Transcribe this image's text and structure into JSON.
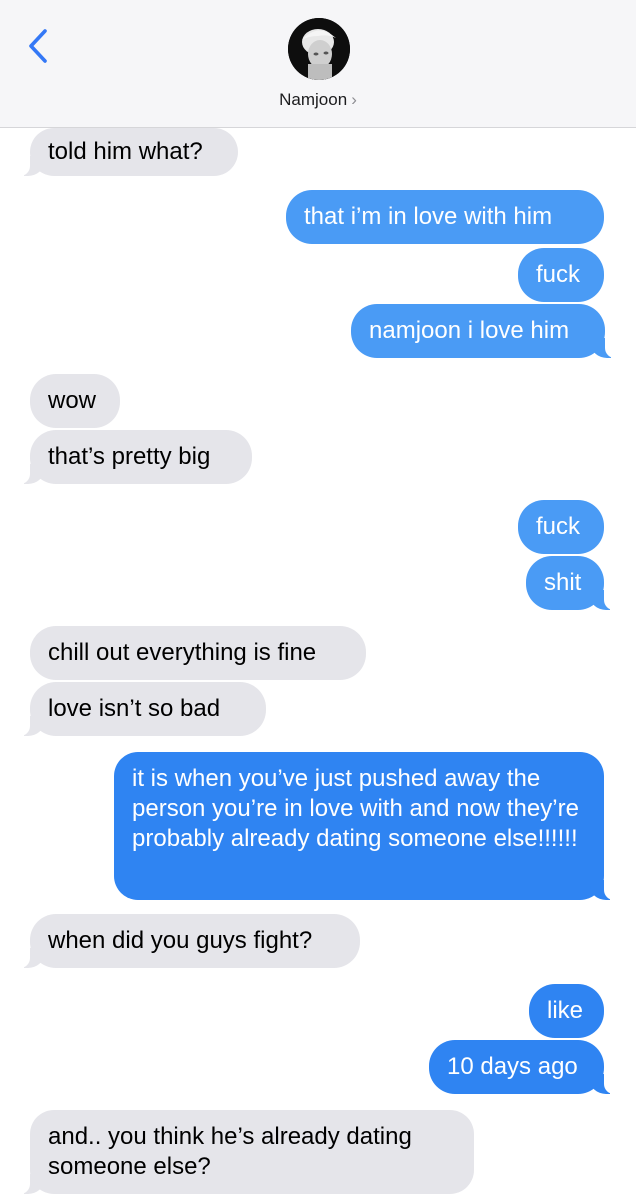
{
  "header": {
    "contact_name": "Namjoon",
    "name_chevron": "›",
    "back_icon": "chevron-left-icon",
    "avatar_icon": "contact-avatar",
    "accent_color": "#3478f6"
  },
  "messages": [
    {
      "sender": "them",
      "text": "told him what?"
    },
    {
      "sender": "me",
      "text": "that i’m in love with him"
    },
    {
      "sender": "me",
      "text": "fuck"
    },
    {
      "sender": "me",
      "text": "namjoon i love him"
    },
    {
      "sender": "them",
      "text": "wow"
    },
    {
      "sender": "them",
      "text": "that’s pretty big"
    },
    {
      "sender": "me",
      "text": "fuck"
    },
    {
      "sender": "me",
      "text": "shit"
    },
    {
      "sender": "them",
      "text": "chill out everything is fine"
    },
    {
      "sender": "them",
      "text": "love isn’t so bad"
    },
    {
      "sender": "me",
      "text": "it is when you’ve just pushed away the person you’re in love with and now they’re probably already dating someone else!!!!!!"
    },
    {
      "sender": "them",
      "text": "when did you guys fight?"
    },
    {
      "sender": "me",
      "text": "like"
    },
    {
      "sender": "me",
      "text": "10 days ago"
    },
    {
      "sender": "them",
      "text": "and.. you think he’s already dating someone else?"
    }
  ],
  "colors": {
    "incoming_bubble": "#e5e5ea",
    "outgoing_bubble": "#4a9bf5",
    "outgoing_bubble_dark": "#2f84f2"
  }
}
